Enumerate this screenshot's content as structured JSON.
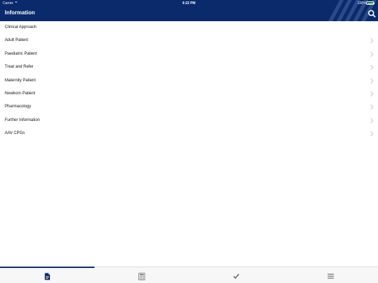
{
  "status_bar": {
    "carrier": "Carrier",
    "wifi_icon": "wifi-icon",
    "time": "6:22 PM",
    "battery": "100%",
    "battery_icon": "battery-icon"
  },
  "header": {
    "title": "Information",
    "search_icon": "search-icon",
    "color": "#0a2a6b"
  },
  "list": {
    "items": [
      {
        "label": "Clinical Approach",
        "has_chevron": false
      },
      {
        "label": "Adult Patient",
        "has_chevron": true
      },
      {
        "label": "Paediatric Patient",
        "has_chevron": true
      },
      {
        "label": "Treat and Refer",
        "has_chevron": true
      },
      {
        "label": "Maternity Patient",
        "has_chevron": true
      },
      {
        "label": "Newborn Patient",
        "has_chevron": true
      },
      {
        "label": "Pharmacology",
        "has_chevron": true
      },
      {
        "label": "Further Information",
        "has_chevron": true
      },
      {
        "label": "AAV CPGs",
        "has_chevron": true
      }
    ]
  },
  "tabbar": {
    "active_index": 0,
    "tabs": [
      {
        "icon": "document-icon",
        "active": true
      },
      {
        "icon": "calculator-icon",
        "active": false
      },
      {
        "icon": "checkmark-icon",
        "active": false
      },
      {
        "icon": "menu-icon",
        "active": false
      }
    ]
  }
}
